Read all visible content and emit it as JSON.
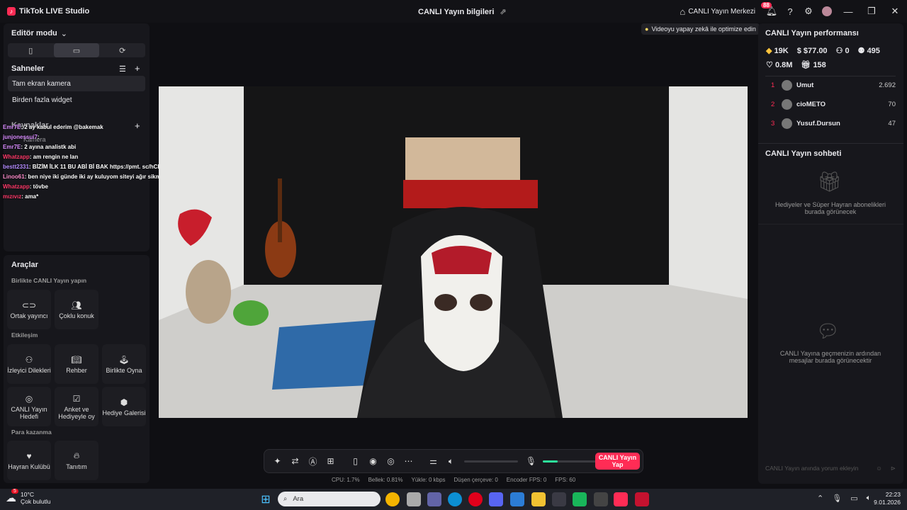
{
  "titlebar": {
    "app_title": "TikTok LIVE Studio",
    "center_title": "CANLI Yayın bilgileri",
    "live_center": "CANLI Yayın Merkezi",
    "notif_count": "88"
  },
  "left": {
    "editor_mode": "Editör modu",
    "scenes_title": "Sahneler",
    "scenes": [
      "Tam ekran kamera",
      "Birden fazla widget"
    ],
    "sources_title": "Kaynaklar",
    "source_camera": "Kamera",
    "chat_overlay": [
      {
        "user": "Emr7E",
        "msg": ": 2 ay kabul ederim @bakemak",
        "color": "#d98cff"
      },
      {
        "user": "junjonessui7",
        "msg": ":",
        "color": "#d98cff"
      },
      {
        "user": "Emr7E",
        "msg": ": 2 ayına analistk abi",
        "color": "#d98cff"
      },
      {
        "user": "Whatzapp",
        "msg": ": am rengin ne lan",
        "color": "#ff3b6b"
      },
      {
        "user": "bestt2331",
        "msg": ": BİZİM İLK 11 BU ABİ Bİ BAK https://pmt. sc/hCR7CH-WMqwc @BAKEMASK",
        "color": "#b58cff"
      },
      {
        "user": "Linoo61",
        "msg": ": ben niye iki günde iki ay kuluyom siteyi ağır sikme işi var",
        "color": "#ff8ccb"
      },
      {
        "user": "Whatzapp",
        "msg": ": tövbe",
        "color": "#ff3b6b"
      },
      {
        "user": "mızıvız",
        "msg": ": ama*",
        "color": "#ff3b6b"
      }
    ],
    "tools_title": "Araçlar",
    "collab_title": "Birlikte CANLI Yayın yapın",
    "collab": [
      "Ortak yayıncı",
      "Çoklu konuk"
    ],
    "interaction_title": "Etkileşim",
    "interaction": [
      "İzleyici Dilekleri",
      "Rehber",
      "Birlikte Oyna",
      "CANLI Yayın Hedefi",
      "Anket ve Hediyeyle oy",
      "Hediye Galerisi"
    ],
    "earn_title": "Para kazanma",
    "earn": [
      "Hayran Kulübü",
      "Tanıtım"
    ]
  },
  "center": {
    "ai_tip": "Videoyu yapay zekâ ile optimize edin",
    "go_live": "CANLI Yayın Yap",
    "stats": [
      "CPU: 1.7%",
      "Bellek: 0.81%",
      "Yükle: 0 kbps",
      "Düşen çerçeve: 0",
      "Encoder FPS: 0",
      "FPS: 60"
    ],
    "mic_level": 0.28
  },
  "right": {
    "perf_title": "CANLI Yayın performansı",
    "perf": [
      "19K",
      "$77.00",
      "0",
      "495",
      "0.8M",
      "158"
    ],
    "ranking": [
      {
        "rank": "1",
        "name": "Umut",
        "value": "2.692"
      },
      {
        "rank": "2",
        "name": "cioMETO",
        "value": "70"
      },
      {
        "rank": "3",
        "name": "Yusuf.Dursun",
        "value": "47"
      }
    ],
    "chat_title": "CANLI Yayın sohbeti",
    "gifts_empty": "Hediyeler ve Süper Hayran abonelikleri burada görünecek",
    "chat_empty": "CANLI Yayına geçmenizin ardından mesajlar burada görünecektir",
    "comment_placeholder": "CANLI Yayın anında yorum ekleyin"
  },
  "taskbar": {
    "weather_temp": "10°C",
    "weather_desc": "Çok bulutlu",
    "search": "Ara",
    "time": "22:23",
    "date": "9.01.2026",
    "weather_badge": "5"
  }
}
